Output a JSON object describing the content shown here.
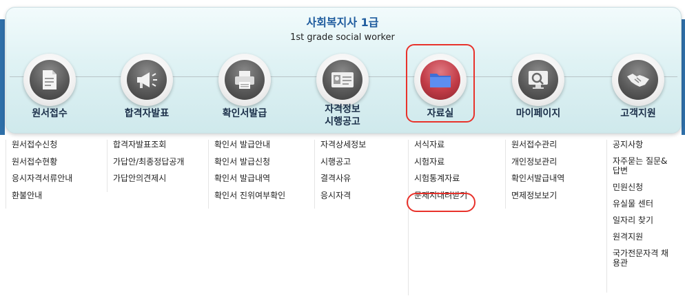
{
  "header": {
    "title": "사회복지사 1급",
    "subtitle": "1st grade social worker"
  },
  "nav": [
    {
      "label": "원서접수",
      "icon": "document-icon"
    },
    {
      "label": "합격자발표",
      "icon": "megaphone-icon"
    },
    {
      "label": "확인서발급",
      "icon": "printer-icon"
    },
    {
      "label": "자격정보\n시행공고",
      "icon": "id-card-icon"
    },
    {
      "label": "자료실",
      "icon": "folder-icon",
      "highlighted": true
    },
    {
      "label": "마이페이지",
      "icon": "monitor-search-icon"
    },
    {
      "label": "고객지원",
      "icon": "handshake-icon"
    }
  ],
  "submenus": [
    [
      "원서접수신청",
      "원서접수현황",
      "응시자격서류안내",
      "환불안내"
    ],
    [
      "합격자발표조회",
      "가답안/최종정답공개",
      "가답안의견제시"
    ],
    [
      "확인서 발급안내",
      "확인서 발급신청",
      "확인서 발급내역",
      "확인서 진위여부확인"
    ],
    [
      "자격상세정보",
      "시행공고",
      "결격사유",
      "응시자격"
    ],
    [
      "서식자료",
      "시험자료",
      "시험통계자료",
      "문제지내려받기"
    ],
    [
      "원서접수관리",
      "개인정보관리",
      "확인서발급내역",
      "면제정보보기"
    ],
    [
      "공지사항",
      "자주묻는 질문&답변",
      "민원신청",
      "유실물 센터",
      "일자리 찾기",
      "원격지원",
      "국가전문자격 채용관"
    ]
  ],
  "colors": {
    "accent": "#1f5c9e",
    "highlight": "#e8312a",
    "panel": "#dff2f4"
  }
}
